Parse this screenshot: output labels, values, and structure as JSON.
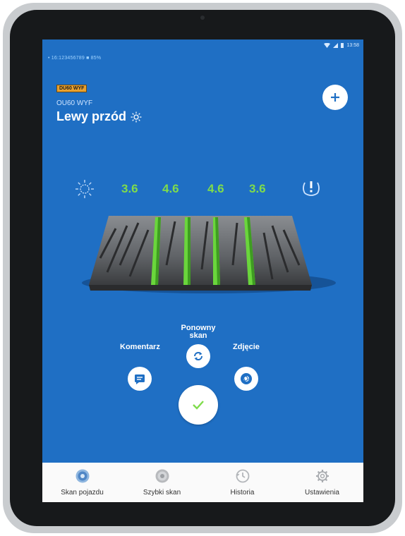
{
  "status_bar": {
    "left_text": "• 16:123456789   ■ 85%",
    "right_text": "13:58"
  },
  "vehicle": {
    "plate_tag": "DU60 WYF",
    "plate": "OU60 WYF",
    "position_title": "Lewy przód"
  },
  "readings": {
    "values": [
      "3.6",
      "4.6",
      "4.6",
      "3.6"
    ],
    "value_color": "#7fdc4b"
  },
  "actions": {
    "rescan_label": "Ponowny skan",
    "comment_label": "Komentarz",
    "photo_label": "Zdjęcie"
  },
  "navbar": {
    "items": [
      {
        "label": "Skan pojazdu",
        "icon": "tyre-scan-icon"
      },
      {
        "label": "Szybki skan",
        "icon": "quick-scan-icon"
      },
      {
        "label": "Historia",
        "icon": "history-icon"
      },
      {
        "label": "Ustawienia",
        "icon": "settings-gear-icon"
      }
    ]
  },
  "colors": {
    "screen_bg": "#1f6fc4",
    "accent_green": "#7fdc4b",
    "tag_orange": "#e9a12e"
  }
}
